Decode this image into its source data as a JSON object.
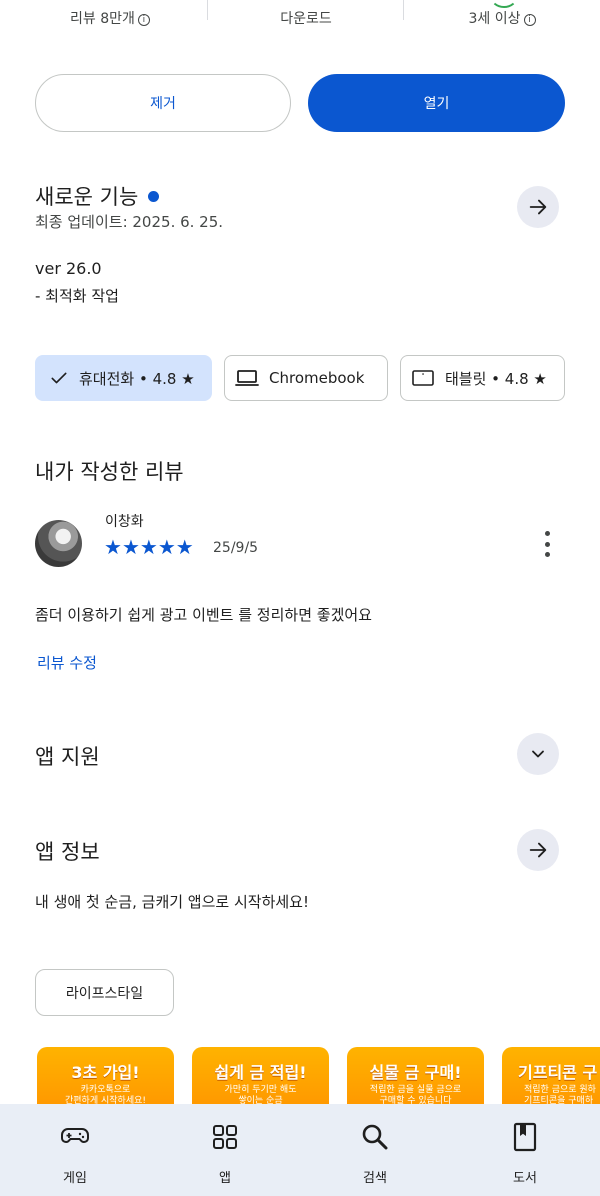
{
  "stats": {
    "reviews": "리뷰 8만개",
    "downloads": "다운로드",
    "age": "3세 이상"
  },
  "actions": {
    "remove_label": "제거",
    "open_label": "열기"
  },
  "whats_new": {
    "title": "새로운 기능",
    "last_updated": "최종 업데이트: 2025. 6. 25.",
    "version": "ver 26.0",
    "notes": "- 최적화 작업"
  },
  "devices": [
    {
      "label": "휴대전화 • 4.8 ★",
      "selected": true
    },
    {
      "label": "Chromebook",
      "selected": false
    },
    {
      "label": "태블릿 • 4.8 ★",
      "selected": false
    }
  ],
  "my_review": {
    "title": "내가 작성한 리뷰",
    "reviewer": "이창화",
    "rating": 5,
    "date": "25/9/5",
    "text": "좀더 이용하기 쉽게 광고 이벤트 를 정리하면 좋겠어요",
    "edit_label": "리뷰 수정"
  },
  "app_support": {
    "title": "앱 지원"
  },
  "app_info": {
    "title": "앱 정보",
    "description": "내 생애 첫 순금, 금캐기 앱으로 시작하세요!",
    "category": "라이프스타일"
  },
  "screenshots": [
    {
      "title": "3초 가입!",
      "sub": "카카오톡으로\n간편하게 시작하세요!"
    },
    {
      "title": "쉽게 금 적립!",
      "sub": "가만히 두기만 해도\n쌓이는 순금"
    },
    {
      "title": "실물 금 구매!",
      "sub": "적립한 금을 실물 금으로\n구매할 수 있습니다"
    },
    {
      "title": "기프티콘 구",
      "sub": "적립한 금으로 원하\n기프티콘을 구매하"
    }
  ],
  "nav": [
    {
      "label": "게임",
      "icon": "gamepad-icon"
    },
    {
      "label": "앱",
      "icon": "apps-grid-icon"
    },
    {
      "label": "검색",
      "icon": "search-icon"
    },
    {
      "label": "도서",
      "icon": "book-icon"
    }
  ],
  "colors": {
    "accent": "#0b57d0",
    "chip_selected_bg": "#d3e3fd",
    "nav_bg": "#e9eef6",
    "screenshot_orange": "#ffa000"
  }
}
